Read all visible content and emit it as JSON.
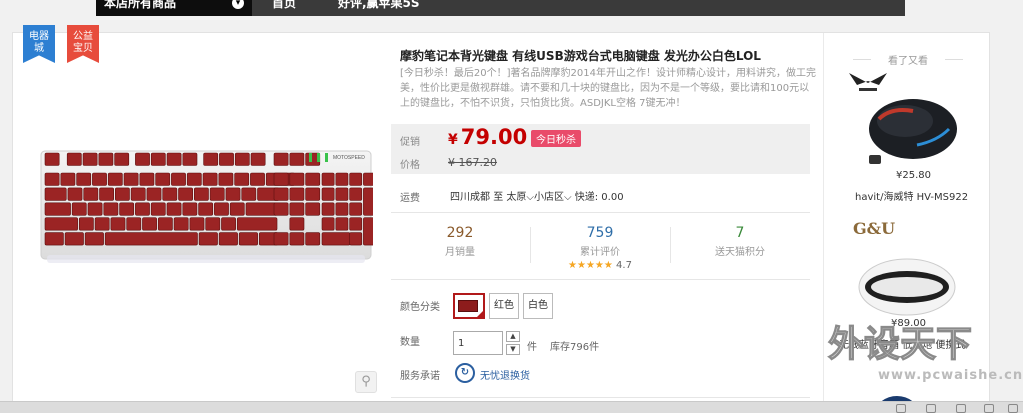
{
  "nav": {
    "dropdown_label": "本店所有商品",
    "links": [
      "首页",
      "好评,赢苹果5S"
    ]
  },
  "badges": {
    "left": "电器城",
    "right": "公益宝贝"
  },
  "product": {
    "title": "摩豹笔记本背光键盘 有线USB游戏台式电脑键盘 发光办公白色LOL",
    "subtitle": "[今日秒杀！最后20个！]著名品牌摩豹2014年开山之作！设计师精心设计，用料讲究，做工完美，性价比更是傲视群雄。请不要和几十块的键盘比，因为不是一个等级，要比请和100元以上的键盘比，不怕不识货，只怕货比货。ASDJKL空格 7键无冲！",
    "keyboard_brand": "MOTOSPEED"
  },
  "price": {
    "promo_label": "促销",
    "price_label": "价格",
    "currency": "¥",
    "current": "79.00",
    "promo_tag": "今日秒杀",
    "original": "¥ 167.20"
  },
  "shipping": {
    "label": "运费",
    "from": "四川成都",
    "to_word": "至",
    "destination": "太原",
    "district": "小店区",
    "cost": "快递: 0.00"
  },
  "stats": [
    {
      "value": "292",
      "label": "月销量",
      "color": "#8a5a2b"
    },
    {
      "value": "759",
      "label": "累计评价",
      "color": "#2f6ea8"
    },
    {
      "value": "7",
      "label": "送天猫积分",
      "color": "#3a8a3a"
    }
  ],
  "rating": {
    "stars": "★★★★★",
    "score": "4.7"
  },
  "options": {
    "color_label": "颜色分类",
    "colors": [
      "红色",
      "白色"
    ],
    "qty_label": "数量",
    "qty_value": "1",
    "qty_unit": "件",
    "stock": "库存796件",
    "promise_label": "服务承诺",
    "promise_text": "无忧退换货"
  },
  "sidebar": {
    "heading": "看了又看",
    "items": [
      {
        "price": "¥25.80",
        "name": "havit/海威特 HV-MS922"
      },
      {
        "brand": "G&U",
        "price": "¥89.00",
        "name": "无线蓝牙音箱 低音炮 便携式"
      }
    ]
  },
  "watermark": {
    "text": "外设天下",
    "url": "www.pcwaishe.cn"
  },
  "colors": {
    "accent_red": "#c40000",
    "promo_pink": "#e94b6a",
    "badge_blue": "#2d7fd2",
    "badge_red": "#e74c3c"
  }
}
